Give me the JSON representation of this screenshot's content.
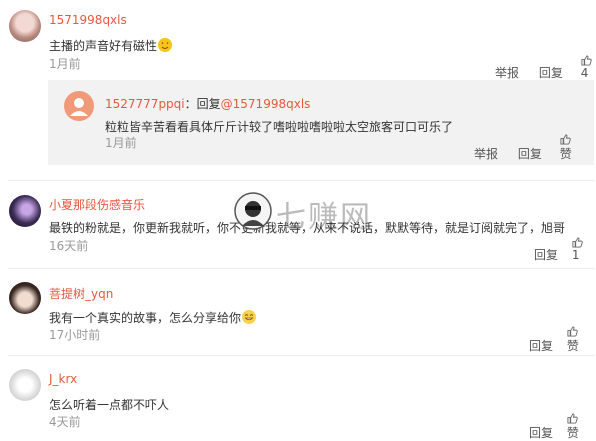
{
  "comments": [
    {
      "username": "1571998qxls",
      "text": "主播的声音好有磁性",
      "emoji": "heart-eyes-emoji",
      "time": "1月前",
      "report": "举报",
      "reply": "回复",
      "likes": "4"
    },
    {
      "username": "小夏那段伤感音乐",
      "text": "最铁的粉就是，你更新我就听，你不更新我就等，从来不说话，默默等待，就是订阅就完了，旭哥",
      "time": "16天前",
      "reply": "回复",
      "likes": "1"
    },
    {
      "username": "菩提树_yqn",
      "text": "我有一个真实的故事，怎么分享给你",
      "emoji": "smiling-emoji",
      "time": "17小时前",
      "reply": "回复",
      "likes": "赞"
    },
    {
      "username": "J_krx",
      "text": "怎么听着一点都不吓人",
      "time": "4天前",
      "reply": "回复",
      "likes": "赞"
    }
  ],
  "reply": {
    "username": "1527777ppqi",
    "prefix": "：回复",
    "mention": "@1571998qxls",
    "text": "粒粒皆辛苦看看具体斤斤计较了嗜啦啦嗜啦啦太空旅客可口可乐了",
    "time": "1月前",
    "report": "举报",
    "reply": "回复",
    "likes": "赞"
  },
  "watermark": {
    "text": "七赚网"
  },
  "colors": {
    "username": "#e8573c",
    "text": "#333333",
    "meta": "#999999",
    "reply_bg": "#f2f2f2"
  }
}
